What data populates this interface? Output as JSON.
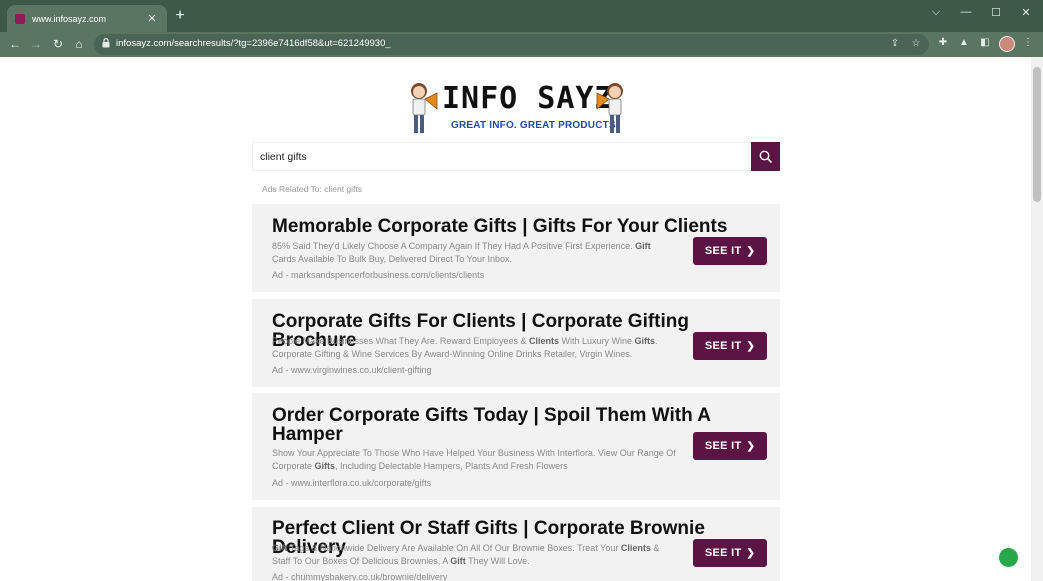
{
  "browser": {
    "tab": {
      "title": "www.infosayz.com",
      "close": "✕"
    },
    "newtab": "+",
    "window_controls": {
      "dropdown": "⌵",
      "minimize": "—",
      "maximize": "☐",
      "close": "✕"
    },
    "nav": {
      "back": "←",
      "forward": "→",
      "reload": "↻",
      "home": "⌂"
    },
    "url": "infosayz.com/searchresults/?tg=2396e7416df58&ut=621249930_",
    "colors": {
      "frame": "#3d5a48",
      "toolbar": "#5b7563"
    }
  },
  "page": {
    "logo": {
      "title": "INFO SAYZ",
      "tagline": "GREAT INFO. GREAT PRODUCTS"
    },
    "search": {
      "value": "client gifts"
    },
    "ads_label": "Ads Related To: client gifts",
    "accent": "#5b1545",
    "ads": [
      {
        "title": "Memorable Corporate Gifts | Gifts For Your Clients",
        "desc_parts": [
          {
            "t": "85% Said They'd Likely Choose A Company Again If They Had A Positive First Experience. "
          },
          {
            "t": "Gift",
            "b": true
          },
          {
            "t": " Cards Available To Bulk Buy, Delivered Direct To Your Inbox."
          }
        ],
        "url": "Ad - marksandspencerforbusiness.com/clients/clients",
        "button": "SEE IT"
      },
      {
        "title": "Corporate Gifts For Clients | Corporate Gifting Brochure",
        "desc_parts": [
          {
            "t": "People Make Businesses What They Are. Reward Employees & "
          },
          {
            "t": "Clients",
            "b": true
          },
          {
            "t": " With Luxury Wine "
          },
          {
            "t": "Gifts",
            "b": true
          },
          {
            "t": ". Corporate Gifting & Wine Services By Award-Winning Online Drinks Retailer, Virgin Wines."
          }
        ],
        "url": "Ad - www.virginwines.co.uk/client-gifting",
        "button": "SEE IT"
      },
      {
        "title": "Order Corporate Gifts Today | Spoil Them With A Hamper",
        "desc_parts": [
          {
            "t": "Show Your Appreciate To Those Who Have Helped Your Business With Interflora. View Our Range Of Corporate "
          },
          {
            "t": "Gifts",
            "b": true
          },
          {
            "t": ", Including Delectable Hampers, Plants And Fresh Flowers"
          }
        ],
        "url": "Ad - www.interflora.co.uk/corporate/gifts",
        "button": "SEE IT"
      },
      {
        "title": "Perfect Client Or Staff Gifts | Corporate Brownie Delivery",
        "desc_parts": [
          {
            "t": "Gift",
            "b": true
          },
          {
            "t": " Tags & Nationwide Delivery Are Available On All Of Our Brownie Boxes. Treat Your "
          },
          {
            "t": "Clients",
            "b": true
          },
          {
            "t": " & Staff To Our Boxes Of Delicious Brownies, A "
          },
          {
            "t": "Gift",
            "b": true
          },
          {
            "t": " They Will Love."
          }
        ],
        "url": "Ad - chummysbakery.co.uk/brownie/delivery",
        "button": "SEE IT"
      }
    ]
  }
}
